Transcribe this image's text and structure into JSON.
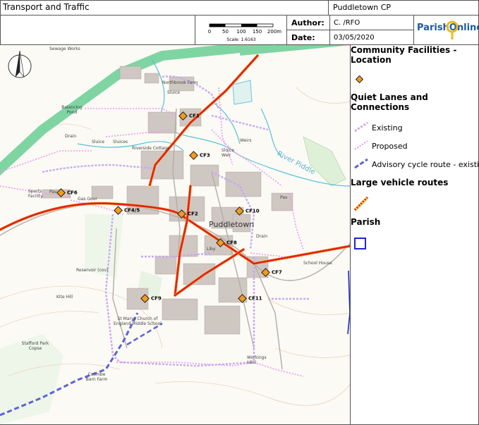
{
  "header": {
    "title": "Transport and Traffic",
    "parish": "Puddletown CP",
    "author_label": "Author:",
    "author_value": "C. /RFO",
    "date_label": "Date:",
    "date_value": "03/05/2020",
    "logo_text": "ParishOnline",
    "scale_ticks": [
      "0",
      "50",
      "100",
      "150",
      "200m"
    ],
    "scale_ratio": "Scale: 1:6163"
  },
  "legend": {
    "community_title": "Community Facilities - Location",
    "quiet_title": "Quiet Lanes and Connections",
    "existing": "Existing",
    "proposed": "Proposed",
    "advisory": "Advisory cycle route - existing",
    "large_vehicle_title": "Large vehicle routes",
    "parish_title": "Parish"
  },
  "map": {
    "town": "Puddletown",
    "facilities": [
      "CF1",
      "CF2",
      "CF3",
      "CF4/5",
      "CF6",
      "CF7",
      "CF8",
      "CF9",
      "CF10",
      "CF11"
    ],
    "labels": {
      "sewage": "Sewage Works",
      "balancing": "Balancing Pond",
      "northbrook": "Northbrook Farm",
      "sluice1": "Sluice",
      "sluice2": "Sluice",
      "sluices": "Sluices",
      "riverside": "Riverside Cottage",
      "weirs": "Weirs",
      "sluice_weir": "Sluice Weir",
      "river": "River Piddle",
      "sports": "Sports Facility",
      "pav": "Pav",
      "gas": "Gas Govr",
      "reservoir": "Reservoir (cov)",
      "kite": "Kite Hill",
      "school": "St Marys Church of England Middle School",
      "school_house": "School House",
      "stafford": "Stafford Park Copse",
      "coombe": "Coombe Barn Farm",
      "workings": "Workings (dis)",
      "liby": "Liby",
      "drain1": "Drain",
      "drain2": "Drain",
      "pav2": "Pav"
    }
  },
  "colors": {
    "road_green": "#7fd5a2",
    "quiet_existing": "#c9a8f2",
    "quiet_proposed": "#ef99ef",
    "advisory": "#5b63d8",
    "large_vehicle_red": "#e2231a",
    "large_vehicle_yellow": "#f7d24a",
    "parish_blue": "#1a29c9",
    "facility_orange": "#f39a1e"
  }
}
